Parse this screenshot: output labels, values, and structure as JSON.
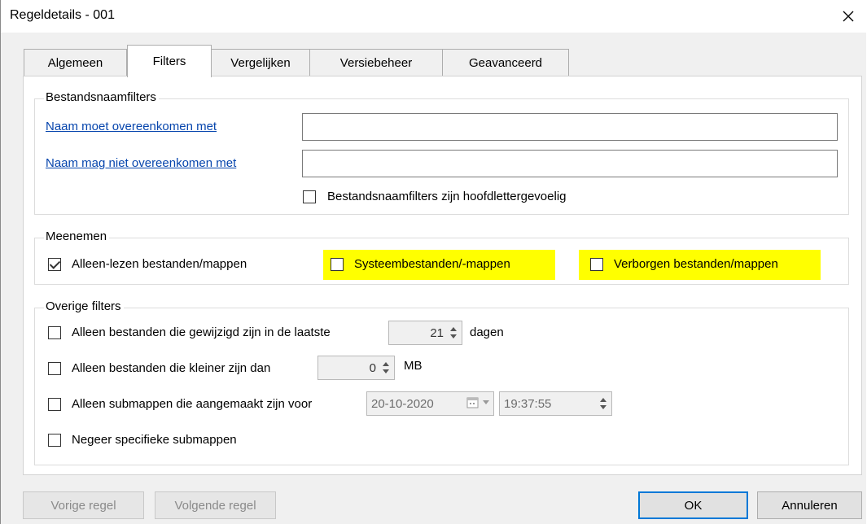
{
  "window": {
    "title": "Regeldetails - 001"
  },
  "tabs": [
    {
      "label": "Algemeen",
      "active": false
    },
    {
      "label": "Filters",
      "active": true
    },
    {
      "label": "Vergelijken",
      "active": false
    },
    {
      "label": "Versiebeheer",
      "active": false
    },
    {
      "label": "Geavanceerd",
      "active": false
    }
  ],
  "filename_filters": {
    "group_label": "Bestandsnaamfilters",
    "include_link": "Naam moet overeenkomen met",
    "include_value": "",
    "exclude_link": "Naam mag niet overeenkomen met",
    "exclude_value": "",
    "case_sensitive_label": "Bestandsnaamfilters zijn hoofdlettergevoelig",
    "case_sensitive_checked": false
  },
  "include": {
    "group_label": "Meenemen",
    "readonly_label": "Alleen-lezen bestanden/mappen",
    "readonly_checked": true,
    "system_label": "Systeembestanden/-mappen",
    "system_checked": false,
    "hidden_label": "Verborgen bestanden/mappen",
    "hidden_checked": false,
    "highlight_color": "#ffff00"
  },
  "other_filters": {
    "group_label": "Overige filters",
    "modified_label": "Alleen bestanden die gewijzigd zijn in de laatste",
    "modified_value": "21",
    "modified_unit": "dagen",
    "smaller_label": "Alleen bestanden die kleiner zijn dan",
    "smaller_value": "0",
    "smaller_unit": "MB",
    "created_label": "Alleen submappen die aangemaakt zijn voor",
    "created_date": "20-10-2020",
    "created_time": "19:37:55",
    "ignore_label": "Negeer specifieke submappen"
  },
  "buttons": {
    "prev": "Vorige regel",
    "next": "Volgende regel",
    "ok": "OK",
    "cancel": "Annuleren"
  },
  "colors": {
    "link": "#0645ad",
    "accent": "#0078d7"
  }
}
